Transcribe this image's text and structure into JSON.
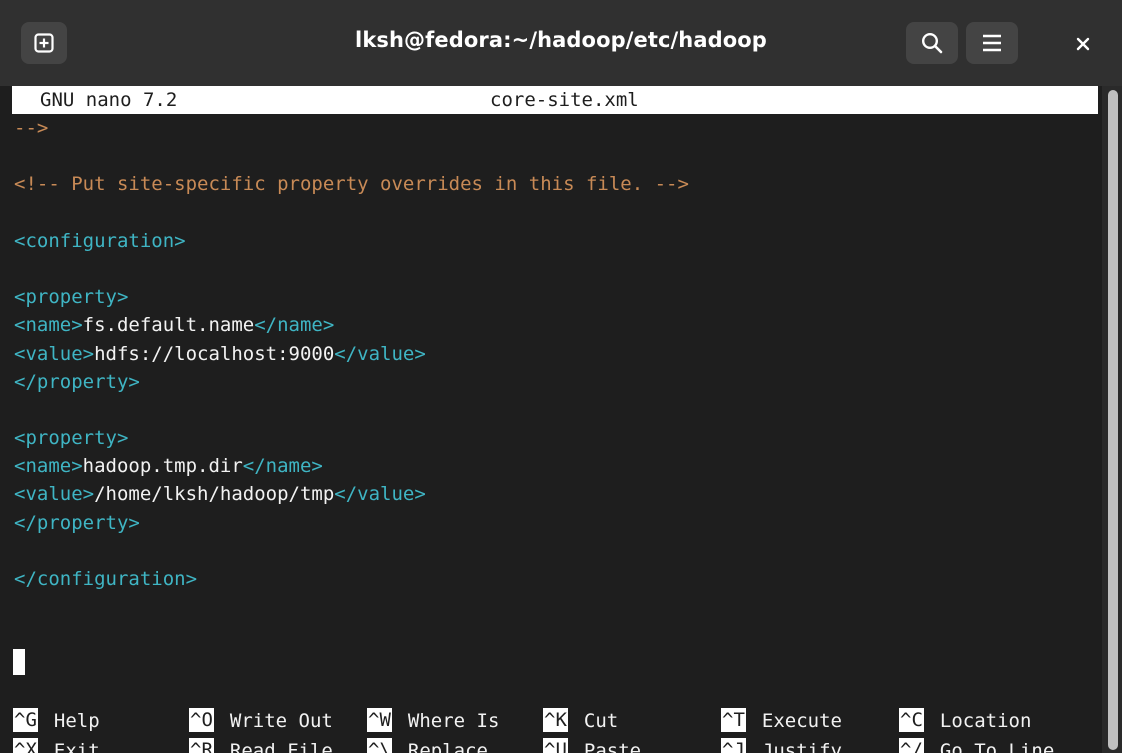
{
  "window": {
    "title": "lksh@fedora:~/hadoop/etc/hadoop"
  },
  "icons": {
    "new_tab": "new-tab-icon",
    "search": "search-icon",
    "menu": "hamburger-menu-icon",
    "close": "close-icon"
  },
  "nano": {
    "version": "GNU nano 7.2",
    "filename": "core-site.xml"
  },
  "colors": {
    "comment": "#c88a56",
    "tag": "#3fb5c4",
    "text": "#f2f2f2",
    "background": "#1e1e1e",
    "titlebar": "#303030"
  },
  "editor": {
    "lines": [
      {
        "parts": [
          {
            "cls": "comment",
            "t": "-->"
          }
        ]
      },
      {
        "parts": []
      },
      {
        "parts": [
          {
            "cls": "comment",
            "t": "<!-- Put site-specific property overrides in this file. -->"
          }
        ]
      },
      {
        "parts": []
      },
      {
        "parts": [
          {
            "cls": "tag",
            "t": "<configuration>"
          }
        ]
      },
      {
        "parts": []
      },
      {
        "parts": [
          {
            "cls": "tag",
            "t": "<property>"
          }
        ]
      },
      {
        "parts": [
          {
            "cls": "tag",
            "t": "<name>"
          },
          {
            "cls": "text",
            "t": "fs.default.name"
          },
          {
            "cls": "tag",
            "t": "</name>"
          }
        ]
      },
      {
        "parts": [
          {
            "cls": "tag",
            "t": "<value>"
          },
          {
            "cls": "text",
            "t": "hdfs://localhost:9000"
          },
          {
            "cls": "tag",
            "t": "</value>"
          }
        ]
      },
      {
        "parts": [
          {
            "cls": "tag",
            "t": "</property>"
          }
        ]
      },
      {
        "parts": []
      },
      {
        "parts": [
          {
            "cls": "tag",
            "t": "<property>"
          }
        ]
      },
      {
        "parts": [
          {
            "cls": "tag",
            "t": "<name>"
          },
          {
            "cls": "text",
            "t": "hadoop.tmp.dir"
          },
          {
            "cls": "tag",
            "t": "</name>"
          }
        ]
      },
      {
        "parts": [
          {
            "cls": "tag",
            "t": "<value>"
          },
          {
            "cls": "text",
            "t": "/home/lksh/hadoop/tmp"
          },
          {
            "cls": "tag",
            "t": "</value>"
          }
        ]
      },
      {
        "parts": [
          {
            "cls": "tag",
            "t": "</property>"
          }
        ]
      },
      {
        "parts": []
      },
      {
        "parts": [
          {
            "cls": "tag",
            "t": "</configuration>"
          }
        ]
      }
    ]
  },
  "shortcuts": {
    "row1": [
      {
        "key": "^G",
        "label": "Help"
      },
      {
        "key": "^O",
        "label": "Write Out"
      },
      {
        "key": "^W",
        "label": "Where Is"
      },
      {
        "key": "^K",
        "label": "Cut"
      },
      {
        "key": "^T",
        "label": "Execute"
      },
      {
        "key": "^C",
        "label": "Location"
      }
    ],
    "row2": [
      {
        "key": "^X",
        "label": "Exit"
      },
      {
        "key": "^R",
        "label": "Read File"
      },
      {
        "key": "^\\",
        "label": "Replace"
      },
      {
        "key": "^U",
        "label": "Paste"
      },
      {
        "key": "^J",
        "label": "Justify"
      },
      {
        "key": "^/",
        "label": "Go To Line"
      }
    ]
  }
}
